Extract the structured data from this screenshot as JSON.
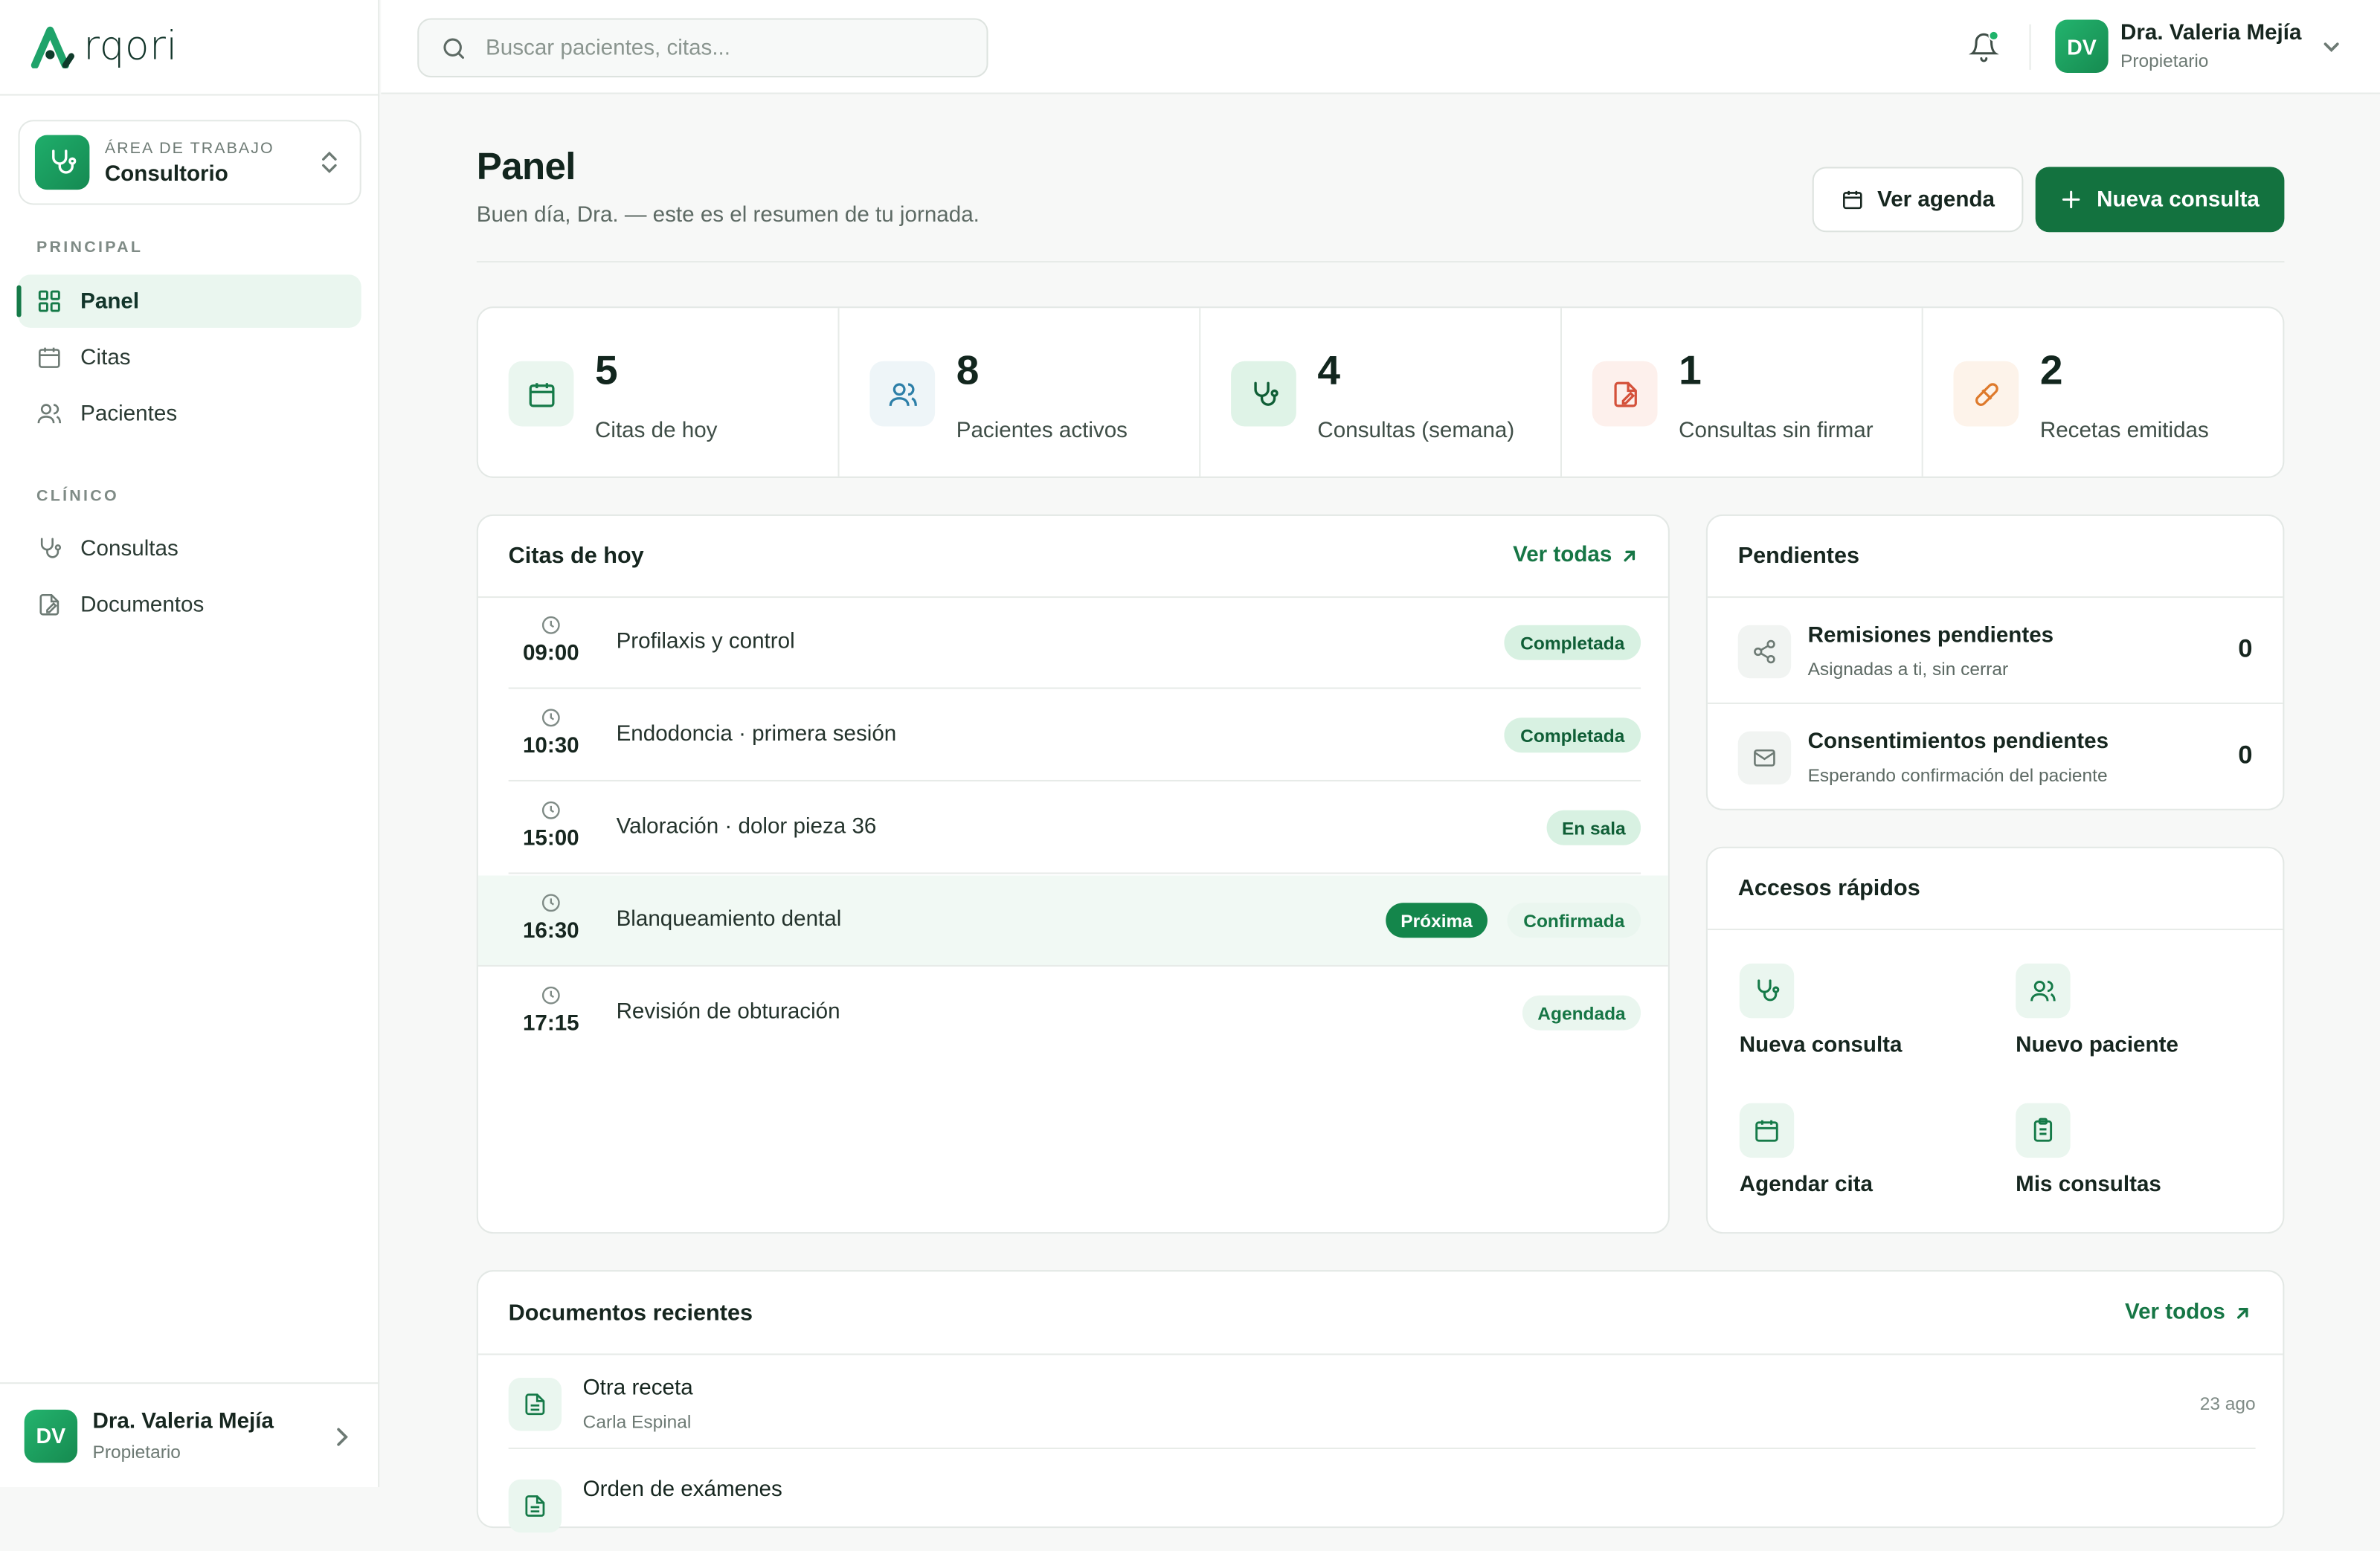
{
  "app": {
    "logo_text": "rqori",
    "brand_color": "#13723f"
  },
  "workspace": {
    "label": "ÁREA DE TRABAJO",
    "name": "Consultorio"
  },
  "sidebar": {
    "section_main": "PRINCIPAL",
    "section_clinic": "CLÍNICO",
    "items": [
      {
        "label": "Panel",
        "icon": "grid-icon",
        "active": true
      },
      {
        "label": "Citas",
        "icon": "calendar-icon"
      },
      {
        "label": "Pacientes",
        "icon": "users-icon"
      },
      {
        "label": "Consultas",
        "icon": "stethoscope-icon"
      },
      {
        "label": "Documentos",
        "icon": "document-edit-icon"
      }
    ],
    "user": {
      "initials": "DV",
      "name": "Dra. Valeria Mejía",
      "role": "Propietario"
    }
  },
  "topbar": {
    "search_placeholder": "Buscar pacientes, citas...",
    "user": {
      "initials": "DV",
      "name": "Dra. Valeria Mejía",
      "role": "Propietario"
    }
  },
  "header": {
    "title": "Panel",
    "subtitle": "Buen día, Dra. — este es el resumen de tu jornada.",
    "btn_agenda": "Ver agenda",
    "btn_new": "Nueva consulta"
  },
  "stats": [
    {
      "value": "5",
      "label": "Citas de hoy",
      "icon": "calendar-icon",
      "color": "#eaf6ef"
    },
    {
      "value": "8",
      "label": "Pacientes activos",
      "icon": "users-icon",
      "color": "#eef5f8"
    },
    {
      "value": "4",
      "label": "Consultas (semana)",
      "icon": "stethoscope-icon",
      "color": "#dff3e7"
    },
    {
      "value": "1",
      "label": "Consultas sin firmar",
      "icon": "document-edit-icon",
      "color": "#fdf0ec"
    },
    {
      "value": "2",
      "label": "Recetas emitidas",
      "icon": "pill-icon",
      "color": "#fdf3ea"
    }
  ],
  "appointments": {
    "title": "Citas de hoy",
    "link": "Ver todas",
    "rows": [
      {
        "time": "09:00",
        "name": "Profilaxis y control",
        "status": "Completada"
      },
      {
        "time": "10:30",
        "name": "Endodoncia · primera sesión",
        "status": "Completada"
      },
      {
        "time": "15:00",
        "name": "Valoración · dolor pieza 36",
        "status": "En sala"
      },
      {
        "time": "16:30",
        "name": "Blanqueamiento dental",
        "next": "Próxima",
        "status": "Confirmada"
      },
      {
        "time": "17:15",
        "name": "Revisión de obturación",
        "status": "Agendada"
      }
    ]
  },
  "pending": {
    "title": "Pendientes",
    "rows": [
      {
        "title": "Remisiones pendientes",
        "sub": "Asignadas a ti, sin cerrar",
        "count": "0",
        "icon": "share-icon"
      },
      {
        "title": "Consentimientos pendientes",
        "sub": "Esperando confirmación del paciente",
        "count": "0",
        "icon": "mail-icon"
      }
    ]
  },
  "quick": {
    "title": "Accesos rápidos",
    "items": [
      {
        "label": "Nueva consulta",
        "icon": "stethoscope-icon"
      },
      {
        "label": "Nuevo paciente",
        "icon": "users-icon"
      },
      {
        "label": "Agendar cita",
        "icon": "calendar-icon"
      },
      {
        "label": "Mis consultas",
        "icon": "clipboard-icon"
      }
    ]
  },
  "documents": {
    "title": "Documentos recientes",
    "link": "Ver todos",
    "rows": [
      {
        "title": "Otra receta",
        "patient": "Carla Espinal",
        "date": "23 ago"
      },
      {
        "title": "Orden de exámenes",
        "patient": "",
        "date": ""
      }
    ]
  }
}
